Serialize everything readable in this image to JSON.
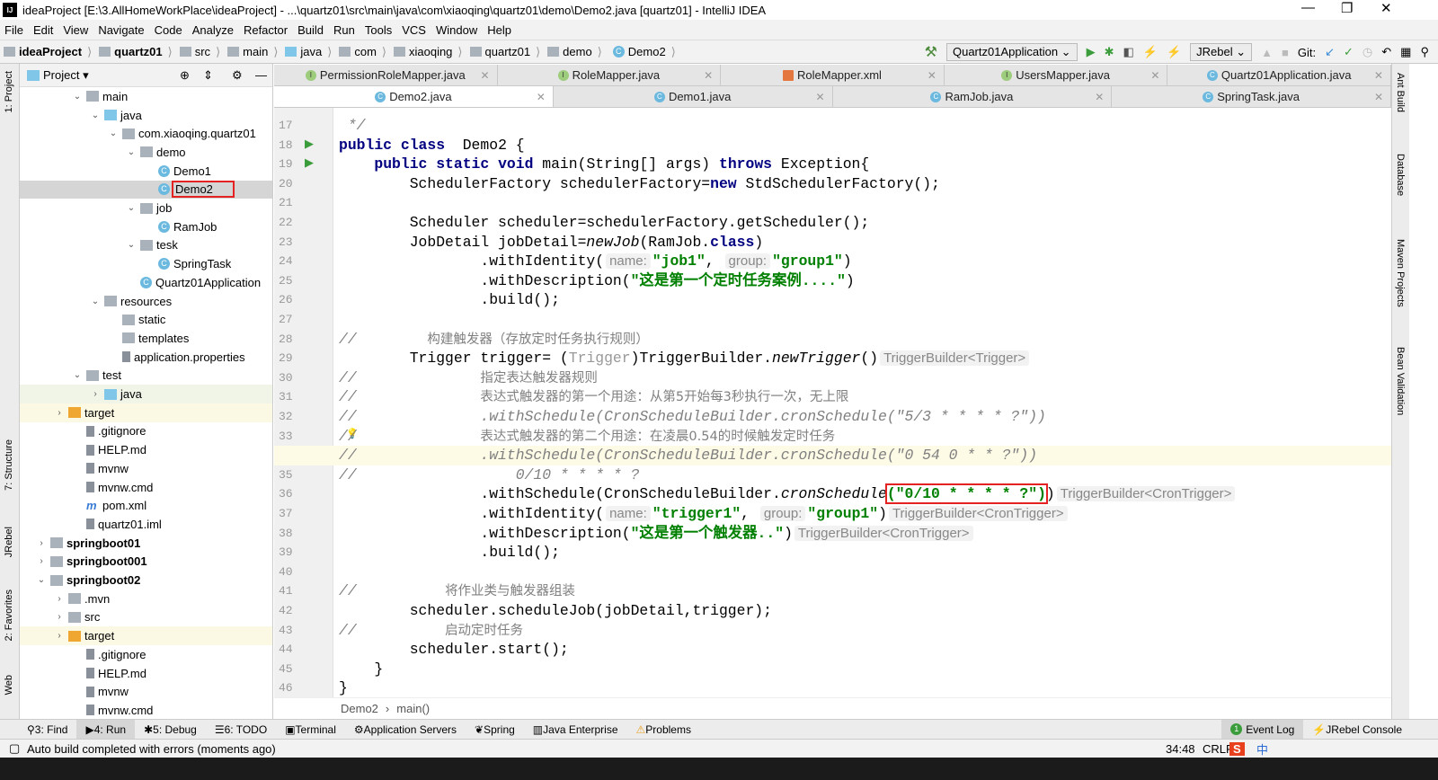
{
  "window": {
    "title": "ideaProject [E:\\3.AllHomeWorkPlace\\ideaProject] - ...\\quartz01\\src\\main\\java\\com\\xiaoqing\\quartz01\\demo\\Demo2.java [quartz01] - IntelliJ IDEA",
    "minimize": "—",
    "maximize": "❐",
    "close": "✕"
  },
  "menu": [
    "File",
    "Edit",
    "View",
    "Navigate",
    "Code",
    "Analyze",
    "Refactor",
    "Build",
    "Run",
    "Tools",
    "VCS",
    "Window",
    "Help"
  ],
  "breadcrumb": [
    "ideaProject",
    "quartz01",
    "src",
    "main",
    "java",
    "com",
    "xiaoqing",
    "quartz01",
    "demo",
    "Demo2"
  ],
  "toolbar": {
    "run_config": "Quartz01Application",
    "jrebel": "JRebel",
    "git_label": "Git:"
  },
  "left_stripe": [
    "1: Project",
    "7: Structure",
    "JRebel",
    "2: Favorites",
    "Web"
  ],
  "right_stripe": [
    "Ant Build",
    "Database",
    "Maven Projects",
    "Bean Validation"
  ],
  "project_panel": {
    "title": "Project"
  },
  "tree": [
    {
      "label": "main",
      "level": 3,
      "arrow": "open",
      "icon": "folder"
    },
    {
      "label": "java",
      "level": 4,
      "arrow": "open",
      "icon": "src"
    },
    {
      "label": "com.xiaoqing.quartz01",
      "level": 5,
      "arrow": "open",
      "icon": "folder"
    },
    {
      "label": "demo",
      "level": 6,
      "arrow": "open",
      "icon": "folder"
    },
    {
      "label": "Demo1",
      "level": 7,
      "icon": "cls"
    },
    {
      "label": "Demo2",
      "level": 7,
      "icon": "cls",
      "selected": true
    },
    {
      "label": "job",
      "level": 6,
      "arrow": "open",
      "icon": "folder"
    },
    {
      "label": "RamJob",
      "level": 7,
      "icon": "cls"
    },
    {
      "label": "tesk",
      "level": 6,
      "arrow": "open",
      "icon": "folder"
    },
    {
      "label": "SpringTask",
      "level": 7,
      "icon": "cls"
    },
    {
      "label": "Quartz01Application",
      "level": 6,
      "icon": "cls"
    },
    {
      "label": "resources",
      "level": 4,
      "arrow": "open",
      "icon": "folder"
    },
    {
      "label": "static",
      "level": 5,
      "icon": "folder"
    },
    {
      "label": "templates",
      "level": 5,
      "icon": "folder"
    },
    {
      "label": "application.properties",
      "level": 5,
      "icon": "file"
    },
    {
      "label": "test",
      "level": 3,
      "arrow": "open",
      "icon": "folder"
    },
    {
      "label": "java",
      "level": 4,
      "arrow": "closed",
      "icon": "src",
      "bg": "#f0f5e8"
    },
    {
      "label": "target",
      "level": 2,
      "arrow": "closed",
      "icon": "orange",
      "bg": "#fbf9e4"
    },
    {
      "label": ".gitignore",
      "level": 3,
      "icon": "file"
    },
    {
      "label": "HELP.md",
      "level": 3,
      "icon": "file"
    },
    {
      "label": "mvnw",
      "level": 3,
      "icon": "file"
    },
    {
      "label": "mvnw.cmd",
      "level": 3,
      "icon": "file"
    },
    {
      "label": "pom.xml",
      "level": 3,
      "icon": "m"
    },
    {
      "label": "quartz01.iml",
      "level": 3,
      "icon": "file"
    },
    {
      "label": "springboot01",
      "level": 1,
      "arrow": "closed",
      "icon": "folder",
      "bold": true
    },
    {
      "label": "springboot001",
      "level": 1,
      "arrow": "closed",
      "icon": "folder",
      "bold": true
    },
    {
      "label": "springboot02",
      "level": 1,
      "arrow": "open",
      "icon": "folder",
      "bold": true
    },
    {
      "label": ".mvn",
      "level": 2,
      "arrow": "closed",
      "icon": "folder"
    },
    {
      "label": "src",
      "level": 2,
      "arrow": "closed",
      "icon": "folder"
    },
    {
      "label": "target",
      "level": 2,
      "arrow": "closed",
      "icon": "orange",
      "bg": "#fbf9e4"
    },
    {
      "label": ".gitignore",
      "level": 3,
      "icon": "file"
    },
    {
      "label": "HELP.md",
      "level": 3,
      "icon": "file"
    },
    {
      "label": "mvnw",
      "level": 3,
      "icon": "file"
    },
    {
      "label": "mvnw.cmd",
      "level": 3,
      "icon": "file"
    }
  ],
  "tabs_row1": [
    {
      "label": "PermissionRoleMapper.java",
      "icon": "I"
    },
    {
      "label": "RoleMapper.java",
      "icon": "I"
    },
    {
      "label": "RoleMapper.xml",
      "icon": "xml"
    },
    {
      "label": "UsersMapper.java",
      "icon": "I"
    },
    {
      "label": "Quartz01Application.java",
      "icon": "C"
    }
  ],
  "tabs_row2": [
    {
      "label": "Demo2.java",
      "icon": "C",
      "active": true
    },
    {
      "label": "Demo1.java",
      "icon": "C"
    },
    {
      "label": "RamJob.java",
      "icon": "C"
    },
    {
      "label": "SpringTask.java",
      "icon": "C"
    }
  ],
  "editor": {
    "first_line": 17,
    "current_line": 34,
    "lines": [
      [
        [
          "cm",
          " */"
        ]
      ],
      [
        [
          "kw",
          "public class"
        ],
        [
          "",
          "  Demo2 {"
        ]
      ],
      [
        [
          "",
          "    "
        ],
        [
          "kw",
          "public static void"
        ],
        [
          "",
          " main(String[] args) "
        ],
        [
          "kw",
          "throws"
        ],
        [
          "",
          " Exception{"
        ]
      ],
      [
        [
          "",
          "        SchedulerFactory schedulerFactory="
        ],
        [
          "kw",
          "new"
        ],
        [
          "",
          " StdSchedulerFactory();"
        ]
      ],
      [],
      [
        [
          "",
          "        Scheduler scheduler=schedulerFactory.getScheduler();"
        ]
      ],
      [
        [
          "",
          "        JobDetail jobDetail="
        ],
        [
          "it",
          "newJob"
        ],
        [
          "",
          "(RamJob."
        ],
        [
          "kw",
          "class"
        ],
        [
          "",
          ")"
        ]
      ],
      [
        [
          "",
          "                .withIdentity("
        ],
        [
          "hint",
          "name:"
        ],
        [
          "str",
          "\"job1\""
        ],
        [
          "",
          ", "
        ],
        [
          "hint",
          "group:"
        ],
        [
          "str",
          "\"group1\""
        ],
        [
          "",
          ")"
        ]
      ],
      [
        [
          "",
          "                .withDescription("
        ],
        [
          "str",
          "\"这是第一个定时任务案例....\""
        ],
        [
          "",
          ")"
        ]
      ],
      [
        [
          "",
          "                .build();"
        ]
      ],
      [],
      [
        [
          "cm",
          "//"
        ],
        [
          "",
          "        "
        ],
        [
          "cmz",
          "构建触发器（存放定时任务执行规则）"
        ]
      ],
      [
        [
          "",
          "        Trigger trigger= ("
        ],
        [
          "gr",
          "Trigger"
        ],
        [
          "",
          ")TriggerBuilder."
        ],
        [
          "it",
          "newTrigger"
        ],
        [
          "",
          "()"
        ],
        [
          "hint",
          "TriggerBuilder<Trigger>"
        ]
      ],
      [
        [
          "cm",
          "//"
        ],
        [
          "",
          "              "
        ],
        [
          "cmz",
          "指定表达触发器规则"
        ]
      ],
      [
        [
          "cm",
          "//"
        ],
        [
          "",
          "              "
        ],
        [
          "cmz",
          "表达式触发器的第一个用途：从第5开始每3秒执行一次，无上限"
        ]
      ],
      [
        [
          "cm",
          "//              .withSchedule(CronScheduleBuilder.cronSchedule(\"5/3 * * * * ?\"))"
        ]
      ],
      [
        [
          "cm",
          "//"
        ],
        [
          "",
          "              "
        ],
        [
          "cmz",
          "表达式触发器的第二个用途：在凌晨0.54的时候触发定时任务"
        ]
      ],
      [
        [
          "cm",
          "//              .withSchedule(CronScheduleBuilder.cronSchedule(\"0 54 0 * * ?\"))"
        ]
      ],
      [
        [
          "cm",
          "//                  0/10 * * * * ?"
        ]
      ],
      [
        [
          "",
          "                .withSchedule(CronScheduleBuilder."
        ],
        [
          "it",
          "cronSchedule"
        ],
        [
          "redbox",
          "(\"0/10 * * * * ?\")"
        ],
        [
          "",
          ")"
        ],
        [
          "hint",
          "TriggerBuilder<CronTrigger>"
        ]
      ],
      [
        [
          "",
          "                .withIdentity("
        ],
        [
          "hint",
          "name:"
        ],
        [
          "str",
          "\"trigger1\""
        ],
        [
          "",
          ", "
        ],
        [
          "hint",
          "group:"
        ],
        [
          "str",
          "\"group1\""
        ],
        [
          "",
          ")"
        ],
        [
          "hint",
          "TriggerBuilder<CronTrigger>"
        ]
      ],
      [
        [
          "",
          "                .withDescription("
        ],
        [
          "str",
          "\"这是第一个触发器..\""
        ],
        [
          "",
          ")"
        ],
        [
          "hint",
          "TriggerBuilder<CronTrigger>"
        ]
      ],
      [
        [
          "",
          "                .build();"
        ]
      ],
      [],
      [
        [
          "cm",
          "//"
        ],
        [
          "",
          "          "
        ],
        [
          "cmz",
          "将作业类与触发器组装"
        ]
      ],
      [
        [
          "",
          "        scheduler.scheduleJob(jobDetail,trigger);"
        ]
      ],
      [
        [
          "cm",
          "//"
        ],
        [
          "",
          "          "
        ],
        [
          "cmz",
          "启动定时任务"
        ]
      ],
      [
        [
          "",
          "        scheduler.start();"
        ]
      ],
      [
        [
          "",
          "    }"
        ]
      ],
      [
        [
          "",
          "}"
        ]
      ]
    ]
  },
  "editor_breadcrumb": [
    "Demo2",
    "main()"
  ],
  "bottom_tools": [
    "3: Find",
    "4: Run",
    "5: Debug",
    "6: TODO",
    "Terminal",
    "Application Servers",
    "Spring",
    "Java Enterprise",
    "Problems"
  ],
  "bottom_right": {
    "event_log": "Event Log",
    "event_count": "1",
    "jrebel_console": "JRebel Console"
  },
  "status": {
    "message": "Auto build completed with errors (moments ago)",
    "position": "34:48",
    "line_sep": "CRLF",
    "ime": "中"
  }
}
